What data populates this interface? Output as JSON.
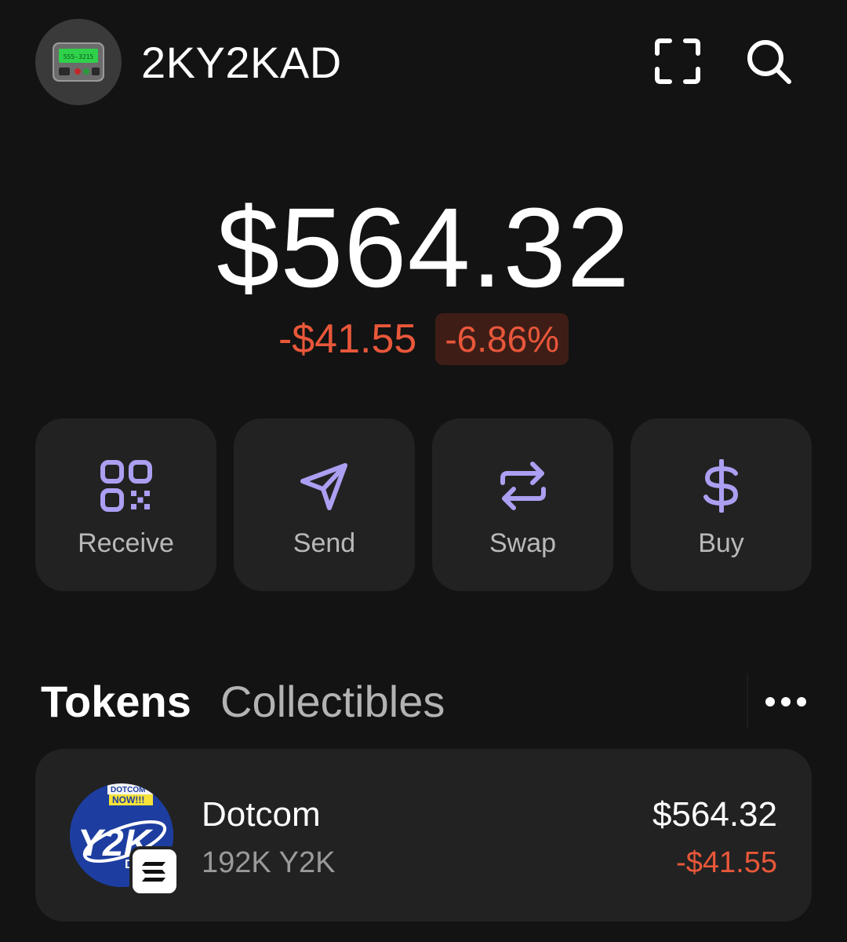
{
  "header": {
    "account_name": "2KY2KAD",
    "avatar_text": "555-3215",
    "avatar_icon": "pager-icon",
    "scan_icon": "scan-icon",
    "search_icon": "search-icon"
  },
  "balance": {
    "total": "$564.32",
    "change_amount": "-$41.55",
    "change_percent": "-6.86%"
  },
  "colors": {
    "background": "#131313",
    "card": "#222222",
    "accent": "#ab9ff2",
    "negative": "#e9573a",
    "negative_bg": "#3f1d17"
  },
  "actions": [
    {
      "label": "Receive",
      "icon": "qr-code-icon"
    },
    {
      "label": "Send",
      "icon": "send-icon"
    },
    {
      "label": "Swap",
      "icon": "swap-icon"
    },
    {
      "label": "Buy",
      "icon": "dollar-icon"
    }
  ],
  "tabs": {
    "tokens": "Tokens",
    "collectibles": "Collectibles",
    "more_icon": "more-horizontal-icon"
  },
  "tokens": [
    {
      "name": "Dotcom",
      "quantity": "192K Y2K",
      "value": "$564.32",
      "change": "-$41.55",
      "logo_text_top": "DOTCOM",
      "logo_text_banner": "NOW!!!",
      "logo_text_main": "Y2K",
      "logo_text_small": "D",
      "chain_icon": "solana-icon"
    }
  ]
}
